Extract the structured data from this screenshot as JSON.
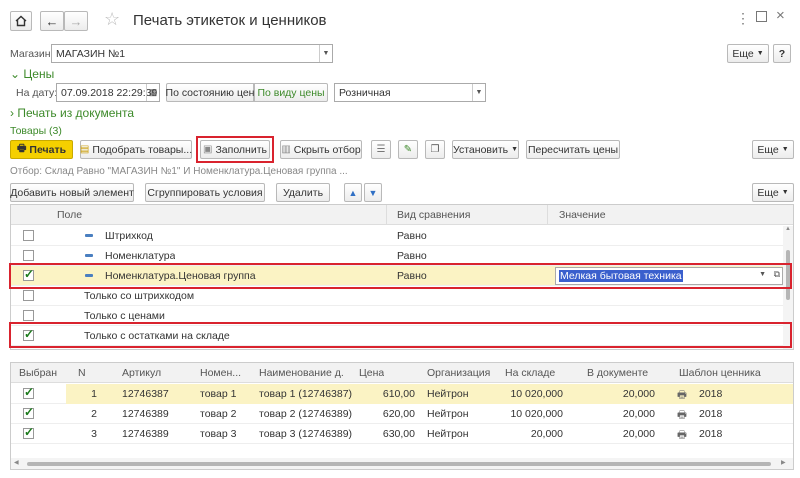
{
  "window": {
    "title": "Печать этикеток и ценников"
  },
  "header": {
    "store_label": "Магазин:",
    "store_value": "МАГАЗИН №1",
    "more_label": "Еще"
  },
  "prices": {
    "section_label": "Цены",
    "date_label": "На дату:",
    "date_value": "07.09.2018 22:29:39",
    "by_state_button": "По состоянию цен",
    "by_type_button": "По виду цены",
    "price_type_value": "Розничная"
  },
  "print_from_doc": "Печать из документа",
  "goods": {
    "title": "Товары (3)",
    "toolbar": {
      "print": "Печать",
      "pick": "Подобрать товары...",
      "fill": "Заполнить",
      "hide_filter": "Скрыть отбор",
      "set": "Установить",
      "recalc": "Пересчитать цены",
      "more": "Еще"
    },
    "filter_text": "Отбор: Склад Равно \"МАГАЗИН №1\" И Номенклатура.Ценовая группа ...",
    "filter_toolbar": {
      "add": "Добавить новый элемент",
      "group": "Сгруппировать условия",
      "delete": "Удалить",
      "more": "Еще"
    },
    "filter_headers": {
      "field": "Поле",
      "compare": "Вид сравнения",
      "value": "Значение"
    },
    "filter_rows": [
      {
        "field": "Штрихкод",
        "compare": "Равно",
        "value": ""
      },
      {
        "field": "Номенклатура",
        "compare": "Равно",
        "value": ""
      },
      {
        "field": "Номенклатура.Ценовая группа",
        "compare": "Равно",
        "value": "Мелкая бытовая техника"
      },
      {
        "field": "Только со штрихкодом",
        "compare": "",
        "value": ""
      },
      {
        "field": "Только с ценами",
        "compare": "",
        "value": ""
      },
      {
        "field": "Только с остатками на складе",
        "compare": "",
        "value": ""
      }
    ],
    "table_headers": [
      "Выбран",
      "N",
      "Артикул",
      "Номен...",
      "Наименование д...",
      "Цена",
      "Организация",
      "На складе",
      "В документе",
      "Шаблон ценника"
    ],
    "rows": [
      {
        "n": "1",
        "article": "12746387",
        "nom": "товар 1",
        "name": "товар 1 (12746387)",
        "price": "610,00",
        "org": "Нейтрон",
        "stock": "10 020,000",
        "in_doc": "20,000",
        "template": "2018"
      },
      {
        "n": "2",
        "article": "12746389",
        "nom": "товар 2",
        "name": "товар 2 (12746389)",
        "price": "620,00",
        "org": "Нейтрон",
        "stock": "10 020,000",
        "in_doc": "20,000",
        "template": "2018"
      },
      {
        "n": "3",
        "article": "12746389",
        "nom": "товар 3",
        "name": "товар 3 (12746389)",
        "price": "630,00",
        "org": "Нейтрон",
        "stock": "20,000",
        "in_doc": "20,000",
        "template": "2018"
      }
    ]
  },
  "colors": {
    "highlight": "#fbf3c4",
    "red_frame": "#d9232e",
    "green": "#3d8a2a",
    "print_yellow": "#f5d000"
  }
}
